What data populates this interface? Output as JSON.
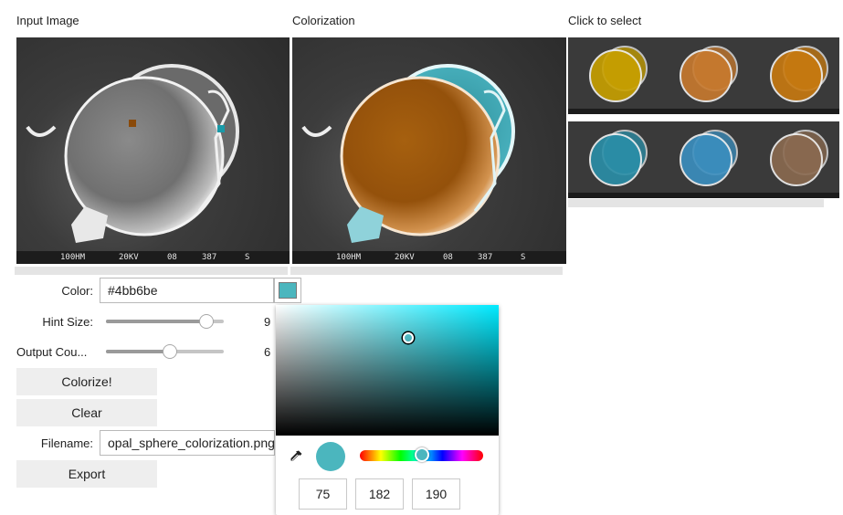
{
  "sections": {
    "input_title": "Input Image",
    "colorization_title": "Colorization",
    "select_title": "Click to select"
  },
  "sem_strip": [
    "100HM",
    "20KV",
    "08",
    "387",
    "S"
  ],
  "controls": {
    "color_label": "Color:",
    "color_value": "#4bb6be",
    "color_accent": "#4bb6be",
    "hint_label": "Hint Size:",
    "hint_value": "9",
    "hint_level": 0.9,
    "output_label": "Output Cou...",
    "output_value": "6",
    "output_level": 0.55,
    "colorize_button": "Colorize!",
    "clear_button": "Clear",
    "filename_label": "Filename:",
    "filename_value": "opal_sphere_colorization.png",
    "export_button": "Export"
  },
  "picker": {
    "r": "75",
    "g": "182",
    "b": "190",
    "hue_level": 0.5,
    "eyedropper_icon": "eyedropper-icon"
  },
  "thumbnails": [
    {
      "tint": "#c8a000"
    },
    {
      "tint": "#c87a2e"
    },
    {
      "tint": "#c87a10"
    },
    {
      "tint": "#2a8fa8"
    },
    {
      "tint": "#3b8fbf"
    },
    {
      "tint": "#8a6a50"
    }
  ],
  "hint_marks": [
    {
      "color": "#8a4a0a"
    },
    {
      "color": "#1a9aa8"
    }
  ]
}
